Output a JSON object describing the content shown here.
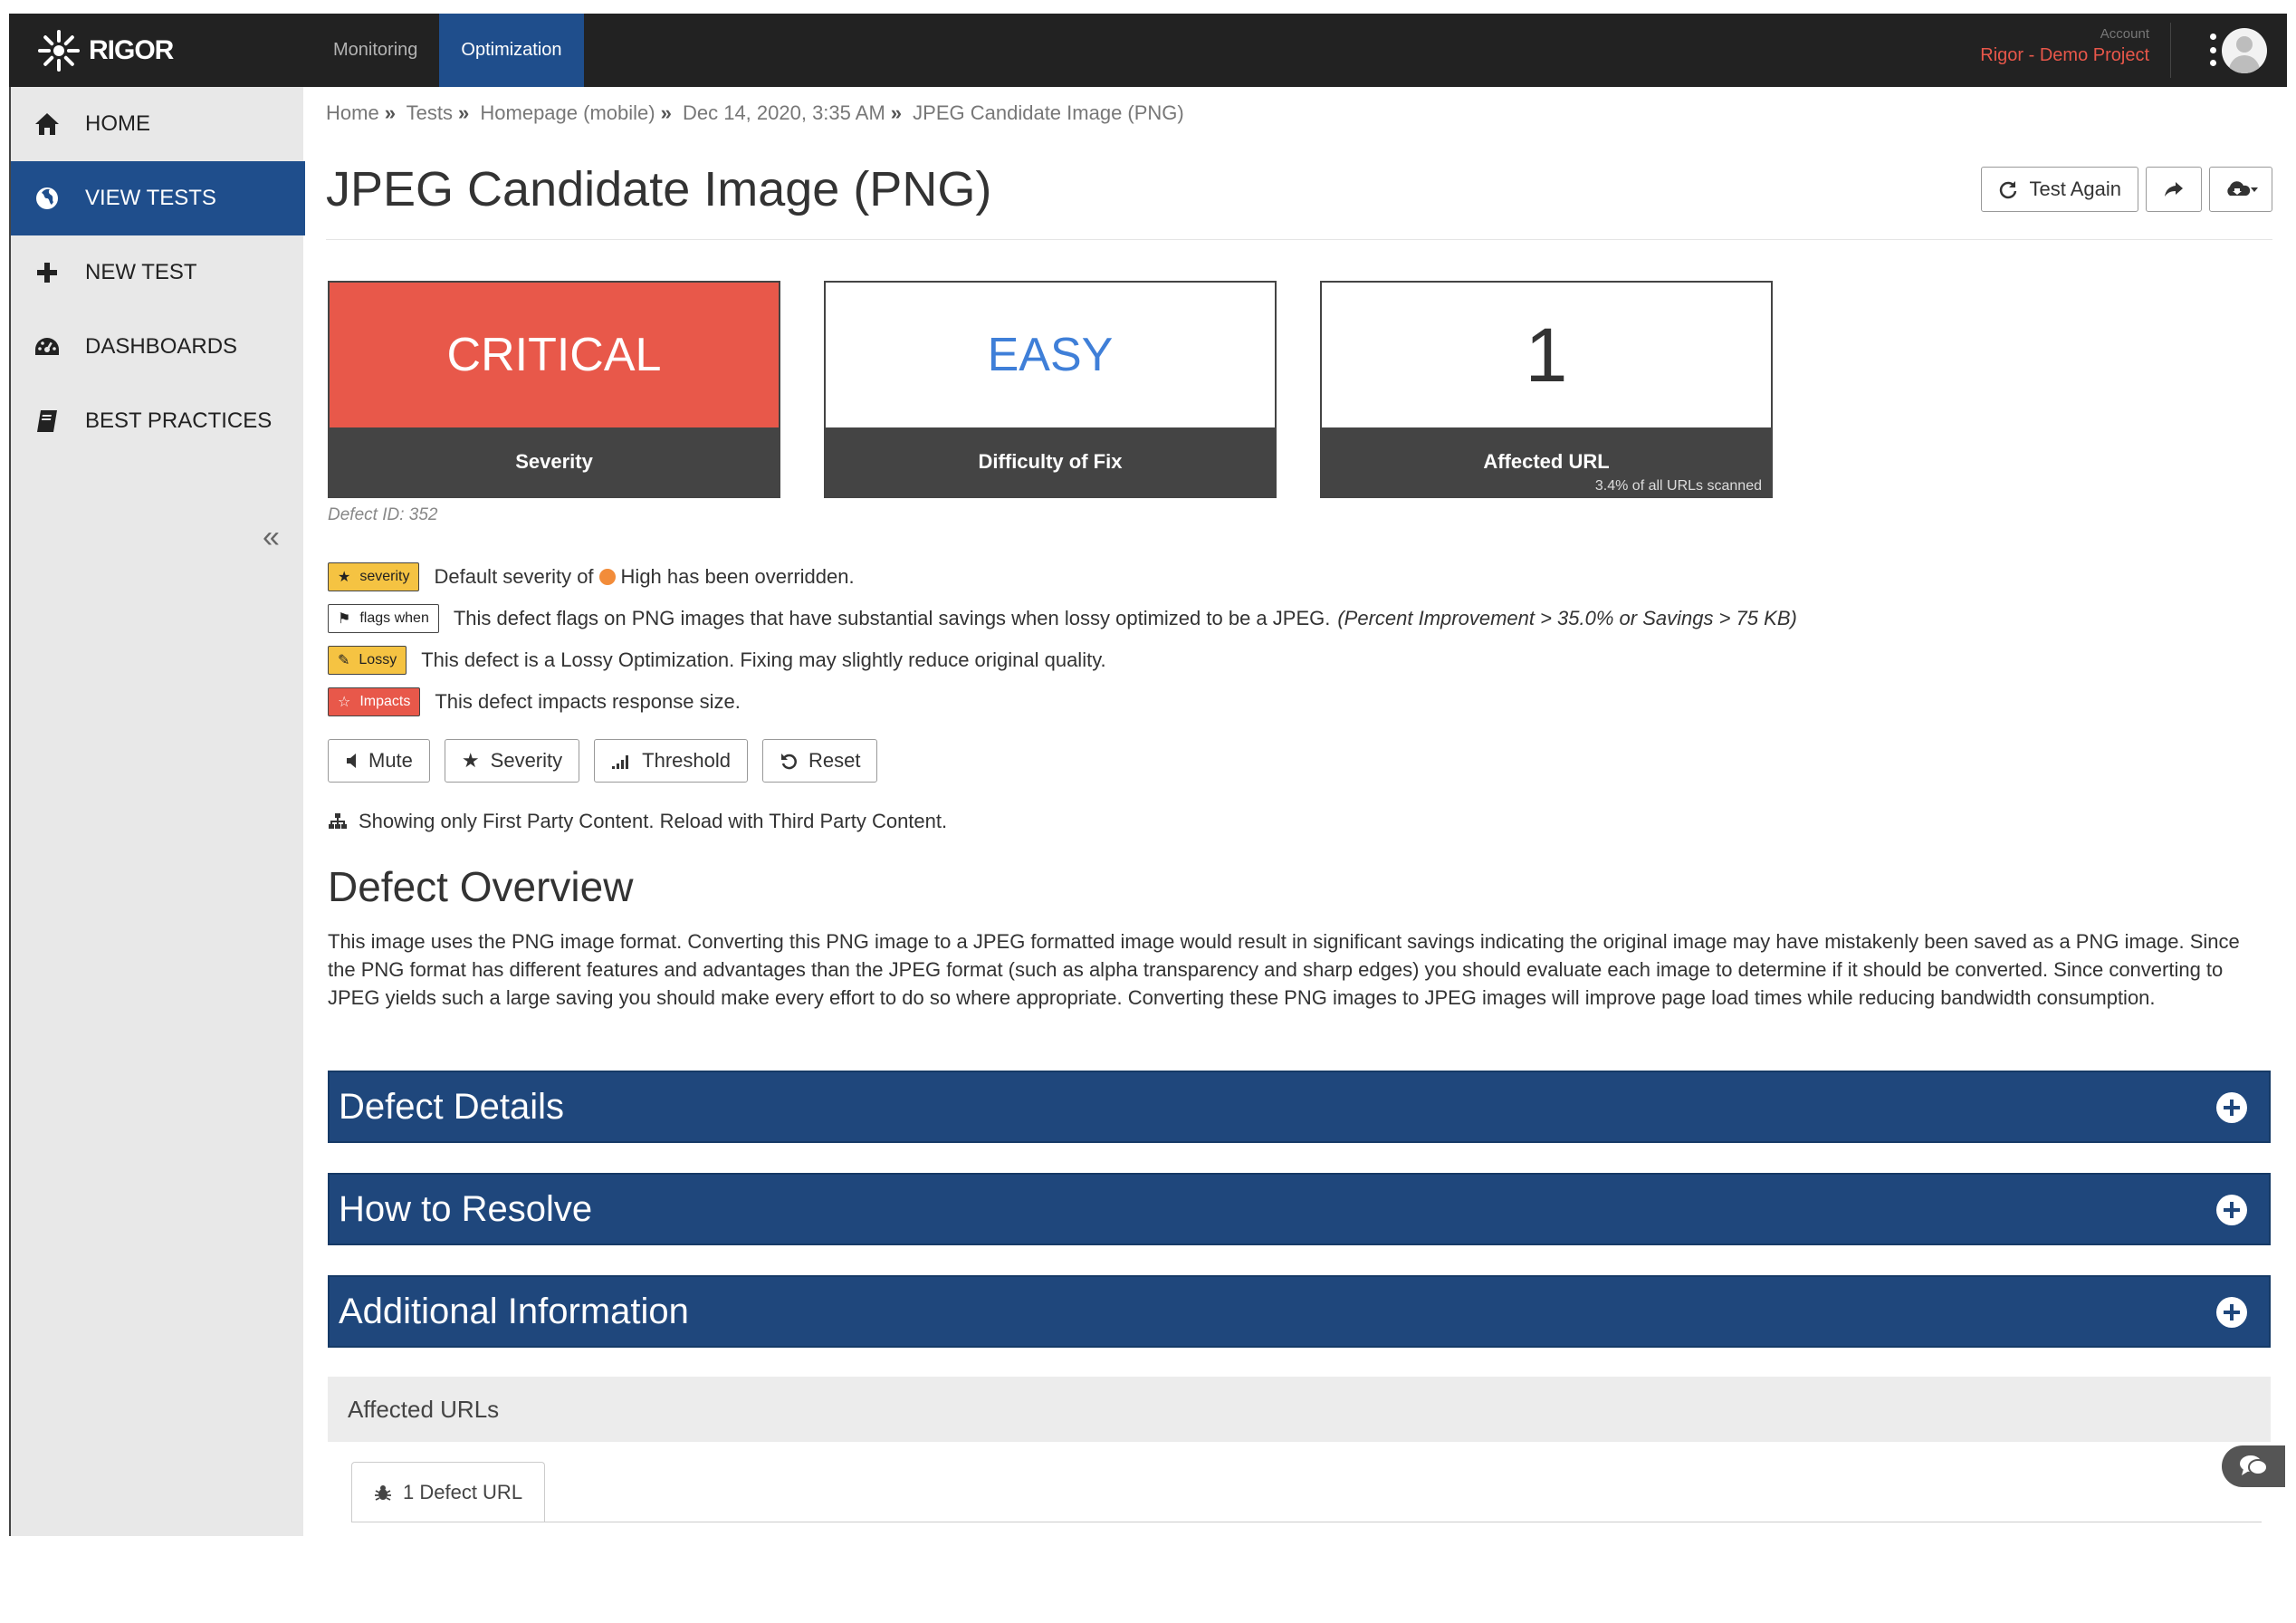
{
  "app": {
    "logo_text": "RIGOR",
    "top_nav": [
      {
        "label": "Monitoring",
        "active": false
      },
      {
        "label": "Optimization",
        "active": true
      }
    ],
    "account_label": "Account",
    "account_name": "Rigor - Demo Project",
    "accent_color": "#1f4e8c"
  },
  "sidebar": {
    "items": [
      {
        "label": "HOME",
        "icon": "home-icon",
        "active": false
      },
      {
        "label": "VIEW TESTS",
        "icon": "globe-icon",
        "active": true
      },
      {
        "label": "NEW TEST",
        "icon": "plus-icon",
        "active": false
      },
      {
        "label": "DASHBOARDS",
        "icon": "dashboard-icon",
        "active": false
      },
      {
        "label": "BEST PRACTICES",
        "icon": "book-icon",
        "active": false
      }
    ],
    "collapse_label": "«"
  },
  "breadcrumb": {
    "items": [
      "Home",
      "Tests",
      "Homepage (mobile)",
      "Dec 14, 2020, 3:35 AM",
      "JPEG Candidate Image (PNG)"
    ],
    "separator": "»"
  },
  "page": {
    "title": "JPEG Candidate Image (PNG)",
    "test_again_label": "Test Again"
  },
  "cards": [
    {
      "value": "CRITICAL",
      "label": "Severity",
      "color": "#e8584a"
    },
    {
      "value": "EASY",
      "label": "Difficulty of Fix",
      "color": "#3f7fd8"
    },
    {
      "value": "1",
      "label": "Affected URL",
      "sub": "3.4% of all URLs scanned"
    }
  ],
  "defect_id": "Defect ID: 352",
  "flags": [
    {
      "tag": "severity",
      "tag_style": "yellow",
      "icon": "star-icon",
      "text_before": "Default severity of",
      "badge_color": "#f28c3a",
      "text_after": "High has been overridden."
    },
    {
      "tag": "flags when",
      "tag_style": "white",
      "icon": "flag-icon",
      "text": "This defect flags on PNG images that have substantial savings when lossy optimized to be a JPEG.",
      "emphasis": "(Percent Improvement > 35.0% or Savings > 75 KB)"
    },
    {
      "tag": "Lossy",
      "tag_style": "yellow",
      "icon": "brush-icon",
      "text": "This defect is a Lossy Optimization. Fixing may slightly reduce original quality."
    },
    {
      "tag": "Impacts",
      "tag_style": "red",
      "icon": "star-outline-icon",
      "text": "This defect impacts response size."
    }
  ],
  "controls": {
    "mute": "Mute",
    "severity": "Severity",
    "threshold": "Threshold",
    "reset": "Reset"
  },
  "party_notice": "Showing only First Party Content. Reload with Third Party Content.",
  "overview": {
    "title": "Defect Overview",
    "text": "This image uses the PNG image format. Converting this PNG image to a JPEG formatted image would result in significant savings indicating the original image may have mistakenly been saved as a PNG image. Since the PNG format has different features and advantages than the JPEG format (such as alpha transparency and sharp edges) you should evaluate each image to determine if it should be converted. Since converting to JPEG yields such a large saving you should make every effort to do so where appropriate. Converting these PNG images to JPEG images will improve page load times while reducing bandwidth consumption."
  },
  "accordions": [
    "Defect Details",
    "How to Resolve",
    "Additional Information"
  ],
  "affected_urls": {
    "title": "Affected URLs",
    "tab_label": "1 Defect URL"
  }
}
